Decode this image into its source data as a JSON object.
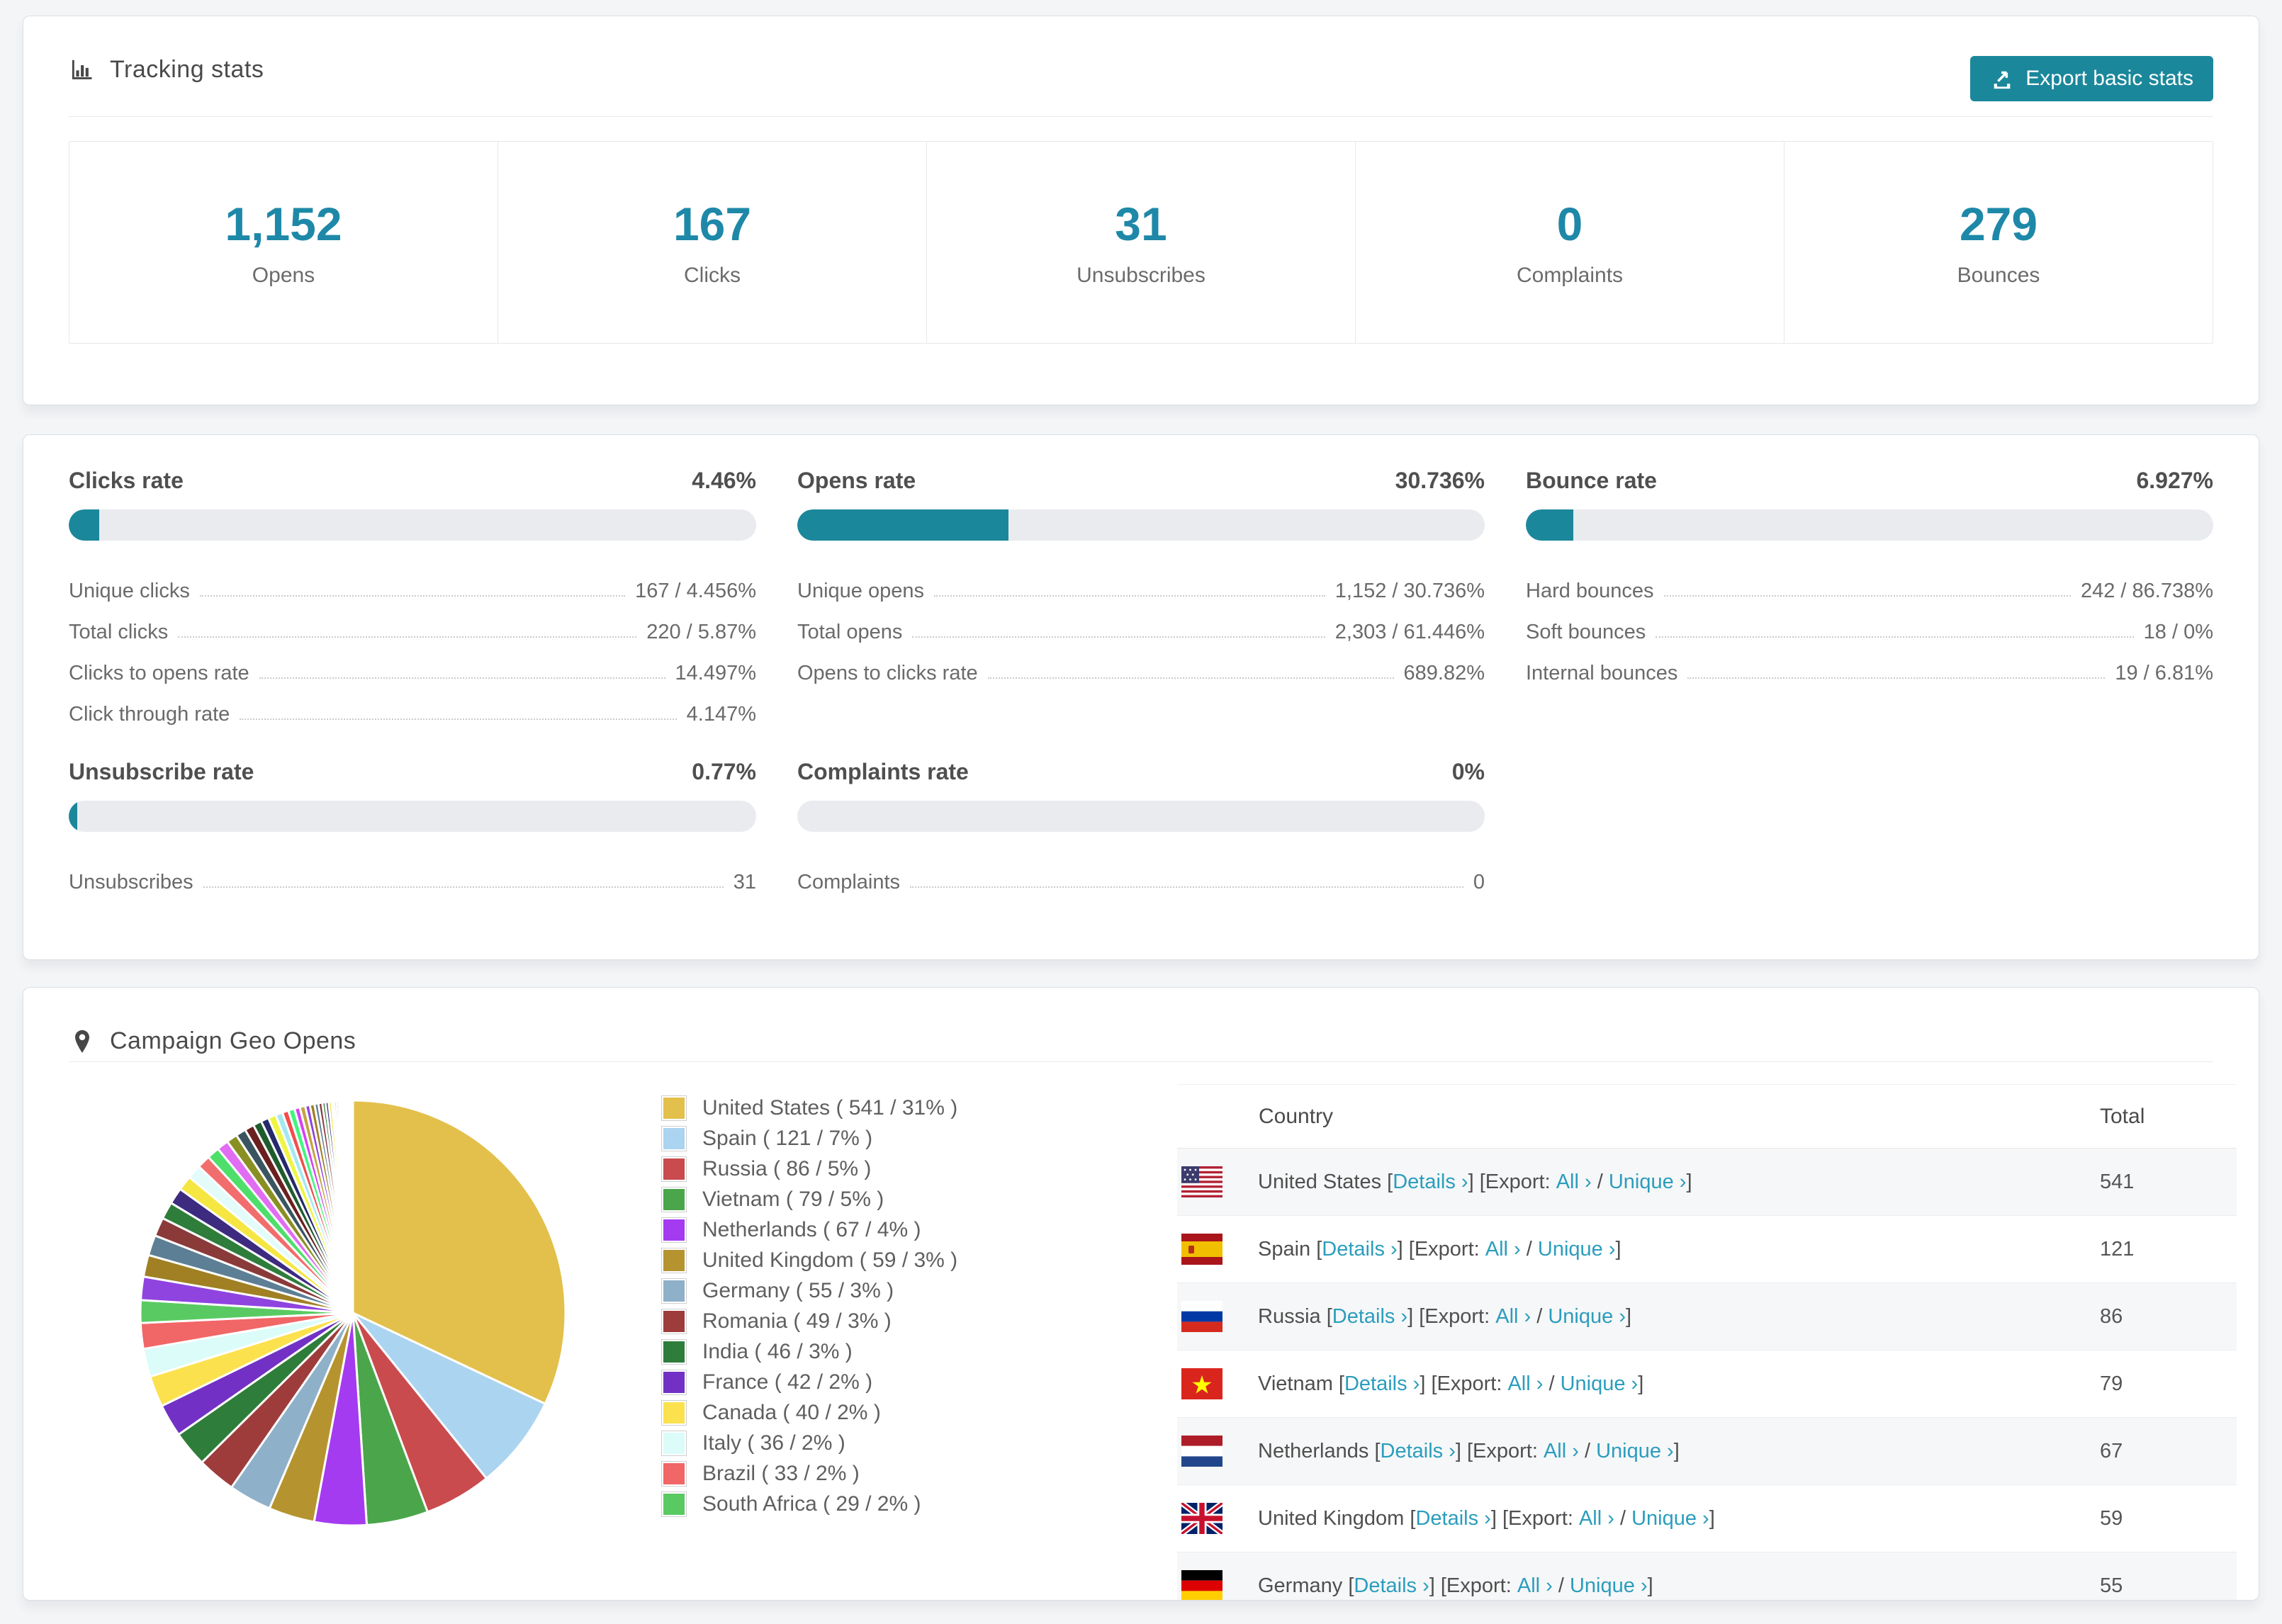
{
  "tracking": {
    "title": "Tracking stats",
    "export_button": "Export basic stats",
    "stats": [
      {
        "value": "1,152",
        "label": "Opens"
      },
      {
        "value": "167",
        "label": "Clicks"
      },
      {
        "value": "31",
        "label": "Unsubscribes"
      },
      {
        "value": "0",
        "label": "Complaints"
      },
      {
        "value": "279",
        "label": "Bounces"
      }
    ]
  },
  "rates": [
    {
      "title": "Clicks rate",
      "value": "4.46%",
      "percent": 4.46,
      "rows": [
        {
          "label": "Unique clicks",
          "value": "167 / 4.456%"
        },
        {
          "label": "Total clicks",
          "value": "220 / 5.87%"
        },
        {
          "label": "Clicks to opens rate",
          "value": "14.497%"
        },
        {
          "label": "Click through rate",
          "value": "4.147%"
        }
      ]
    },
    {
      "title": "Opens rate",
      "value": "30.736%",
      "percent": 30.736,
      "rows": [
        {
          "label": "Unique opens",
          "value": "1,152 / 30.736%"
        },
        {
          "label": "Total opens",
          "value": "2,303 / 61.446%"
        },
        {
          "label": "Opens to clicks rate",
          "value": "689.82%"
        }
      ]
    },
    {
      "title": "Bounce rate",
      "value": "6.927%",
      "percent": 6.927,
      "rows": [
        {
          "label": "Hard bounces",
          "value": "242 / 86.738%"
        },
        {
          "label": "Soft bounces",
          "value": "18 / 0%"
        },
        {
          "label": "Internal bounces",
          "value": "19 / 6.81%"
        }
      ]
    },
    {
      "title": "Unsubscribe rate",
      "value": "0.77%",
      "percent": 0.77,
      "rows": [
        {
          "label": "Unsubscribes",
          "value": "31"
        }
      ]
    },
    {
      "title": "Complaints rate",
      "value": "0%",
      "percent": 0,
      "rows": [
        {
          "label": "Complaints",
          "value": "0"
        }
      ]
    }
  ],
  "geo": {
    "title": "Campaign Geo Opens",
    "table": {
      "country_header": "Country",
      "total_header": "Total",
      "links": {
        "details": "Details ›",
        "export_prefix": "Export:",
        "all": "All ›",
        "unique": "Unique ›"
      },
      "rows": [
        {
          "country": "United States",
          "flag": "us",
          "total": "541"
        },
        {
          "country": "Spain",
          "flag": "es",
          "total": "121"
        },
        {
          "country": "Russia",
          "flag": "ru",
          "total": "86"
        },
        {
          "country": "Vietnam",
          "flag": "vn",
          "total": "79"
        },
        {
          "country": "Netherlands",
          "flag": "nl",
          "total": "67"
        },
        {
          "country": "United Kingdom",
          "flag": "gb",
          "total": "59"
        },
        {
          "country": "Germany",
          "flag": "de",
          "total": "55"
        }
      ]
    },
    "chart_data": {
      "type": "pie",
      "title": "Campaign Geo Opens",
      "legend_position": "right",
      "start_angle_deg": 0,
      "direction": "clockwise",
      "categories": [
        {
          "label": "United States",
          "count": 541,
          "percent": 31,
          "color": "#e3c04b"
        },
        {
          "label": "Spain",
          "count": 121,
          "percent": 7,
          "color": "#abd4f0"
        },
        {
          "label": "Russia",
          "count": 86,
          "percent": 5,
          "color": "#c94b4e"
        },
        {
          "label": "Vietnam",
          "count": 79,
          "percent": 5,
          "color": "#4ba64b"
        },
        {
          "label": "Netherlands",
          "count": 67,
          "percent": 4,
          "color": "#a43bf0"
        },
        {
          "label": "United Kingdom",
          "count": 59,
          "percent": 3,
          "color": "#b5942f"
        },
        {
          "label": "Germany",
          "count": 55,
          "percent": 3,
          "color": "#8fb0c9"
        },
        {
          "label": "Romania",
          "count": 49,
          "percent": 3,
          "color": "#9e3c3c"
        },
        {
          "label": "India",
          "count": 46,
          "percent": 3,
          "color": "#2f7d3b"
        },
        {
          "label": "France",
          "count": 42,
          "percent": 2,
          "color": "#7231c4"
        },
        {
          "label": "Canada",
          "count": 40,
          "percent": 2,
          "color": "#fbe14d"
        },
        {
          "label": "Italy",
          "count": 36,
          "percent": 2,
          "color": "#dcfcf9"
        },
        {
          "label": "Brazil",
          "count": 33,
          "percent": 2,
          "color": "#f16666"
        },
        {
          "label": "South Africa",
          "count": 29,
          "percent": 2,
          "color": "#59ca62"
        }
      ],
      "other_slices": {
        "values": [
          30,
          28,
          26,
          24,
          22,
          21,
          19,
          18,
          17,
          16,
          15,
          14,
          13,
          12,
          11,
          10,
          10,
          9,
          8,
          8,
          7,
          7,
          6,
          6,
          5,
          5,
          4,
          4,
          4,
          3,
          3,
          3,
          2,
          2,
          2,
          2,
          2,
          1,
          1,
          1,
          1,
          1,
          1,
          1,
          1
        ],
        "colors": [
          "#8f44e0",
          "#a08023",
          "#5d7f95",
          "#8b3a3a",
          "#2f7d3b",
          "#3d2b80",
          "#f5e642",
          "#e3fbf9",
          "#f26d6d",
          "#4ddf6a",
          "#e06df2",
          "#8a8f23",
          "#3a5560",
          "#6b2020",
          "#1f5c2d",
          "#252a6b",
          "#eef542",
          "#a3e8f0",
          "#f24d4d",
          "#42f57e",
          "#d342f5",
          "#c2a542"
        ]
      }
    }
  },
  "colors": {
    "accent": "#1b879b",
    "stat_number": "#1e88a8",
    "link": "#2b9dbd",
    "bar_track": "#e9ebef",
    "page_bg": "#f4f5f7"
  }
}
